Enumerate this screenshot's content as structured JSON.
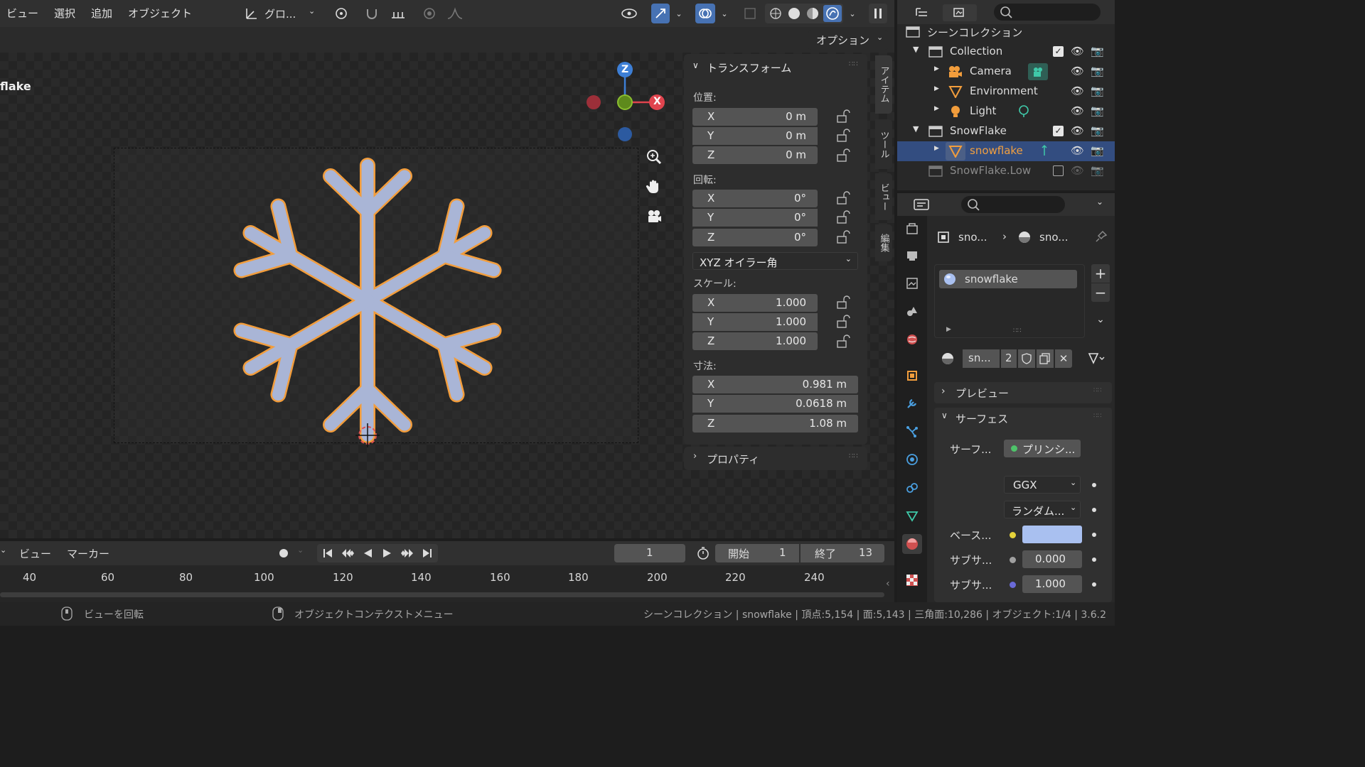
{
  "menu": {
    "view": "ビュー",
    "select": "選択",
    "add": "追加",
    "object": "オブジェクト"
  },
  "header": {
    "transform_orientation": "グロ...",
    "options": "オプション"
  },
  "viewport": {
    "object_name": "flake"
  },
  "npanel": {
    "transform_title": "トランスフォーム",
    "location_label": "位置:",
    "location": [
      {
        "axis": "X",
        "value": "0 m"
      },
      {
        "axis": "Y",
        "value": "0 m"
      },
      {
        "axis": "Z",
        "value": "0 m"
      }
    ],
    "rotation_label": "回転:",
    "rotation": [
      {
        "axis": "X",
        "value": "0°"
      },
      {
        "axis": "Y",
        "value": "0°"
      },
      {
        "axis": "Z",
        "value": "0°"
      }
    ],
    "rotation_mode": "XYZ オイラー角",
    "scale_label": "スケール:",
    "scale": [
      {
        "axis": "X",
        "value": "1.000"
      },
      {
        "axis": "Y",
        "value": "1.000"
      },
      {
        "axis": "Z",
        "value": "1.000"
      }
    ],
    "dimensions_label": "寸法:",
    "dimensions": [
      {
        "axis": "X",
        "value": "0.981 m"
      },
      {
        "axis": "Y",
        "value": "0.0618 m"
      },
      {
        "axis": "Z",
        "value": "1.08 m"
      }
    ],
    "properties_title": "プロパティ",
    "tabs": [
      "アイテム",
      "ツール",
      "ビュー",
      "編集"
    ]
  },
  "gizmo": {
    "z": "Z",
    "x": "X"
  },
  "timeline": {
    "view": "ビュー",
    "marker": "マーカー",
    "current_frame": "1",
    "start_label": "開始",
    "start": "1",
    "end_label": "終了",
    "end": "13",
    "ruler": [
      "40",
      "60",
      "80",
      "100",
      "120",
      "140",
      "160",
      "180",
      "200",
      "220",
      "240"
    ]
  },
  "status": {
    "rotate_view": "ビューを回転",
    "context_menu": "オブジェクトコンテクストメニュー",
    "stats": "シーンコレクション | snowflake | 頂点:5,154 | 面:5,143 | 三角面:10,286 | オブジェクト:1/4 | 3.6.2"
  },
  "outliner": {
    "scene_collection": "シーンコレクション",
    "rows": [
      {
        "name": "Collection"
      },
      {
        "name": "Camera"
      },
      {
        "name": "Environment"
      },
      {
        "name": "Light"
      },
      {
        "name": "SnowFlake"
      },
      {
        "name": "snowflake"
      },
      {
        "name": "SnowFlake.Low"
      }
    ]
  },
  "properties": {
    "breadcrumb_object": "sno...",
    "breadcrumb_material": "sno...",
    "material_slot": "snowflake",
    "material_name": "sn...",
    "users": "2",
    "preview": "プレビュー",
    "surface": "サーフェス",
    "surface_label": "サーフ...",
    "surface_value": "プリンシ...",
    "distribution": "GGX",
    "subsurface_method": "ランダム...",
    "base_color_label": "ベース...",
    "base_color": "#a9c0f0",
    "subsurface_label": "サブサ...",
    "subsurface_value": "0.000",
    "subsurface_radius_label": "サブサ...",
    "subsurface_radius_value": "1.000"
  },
  "colors": {
    "accent": "#4772b3",
    "selected_orange": "#f29d3c",
    "x_axis": "#e0444e",
    "y_axis": "#8bbf2f",
    "z_axis": "#3d7fd6"
  }
}
